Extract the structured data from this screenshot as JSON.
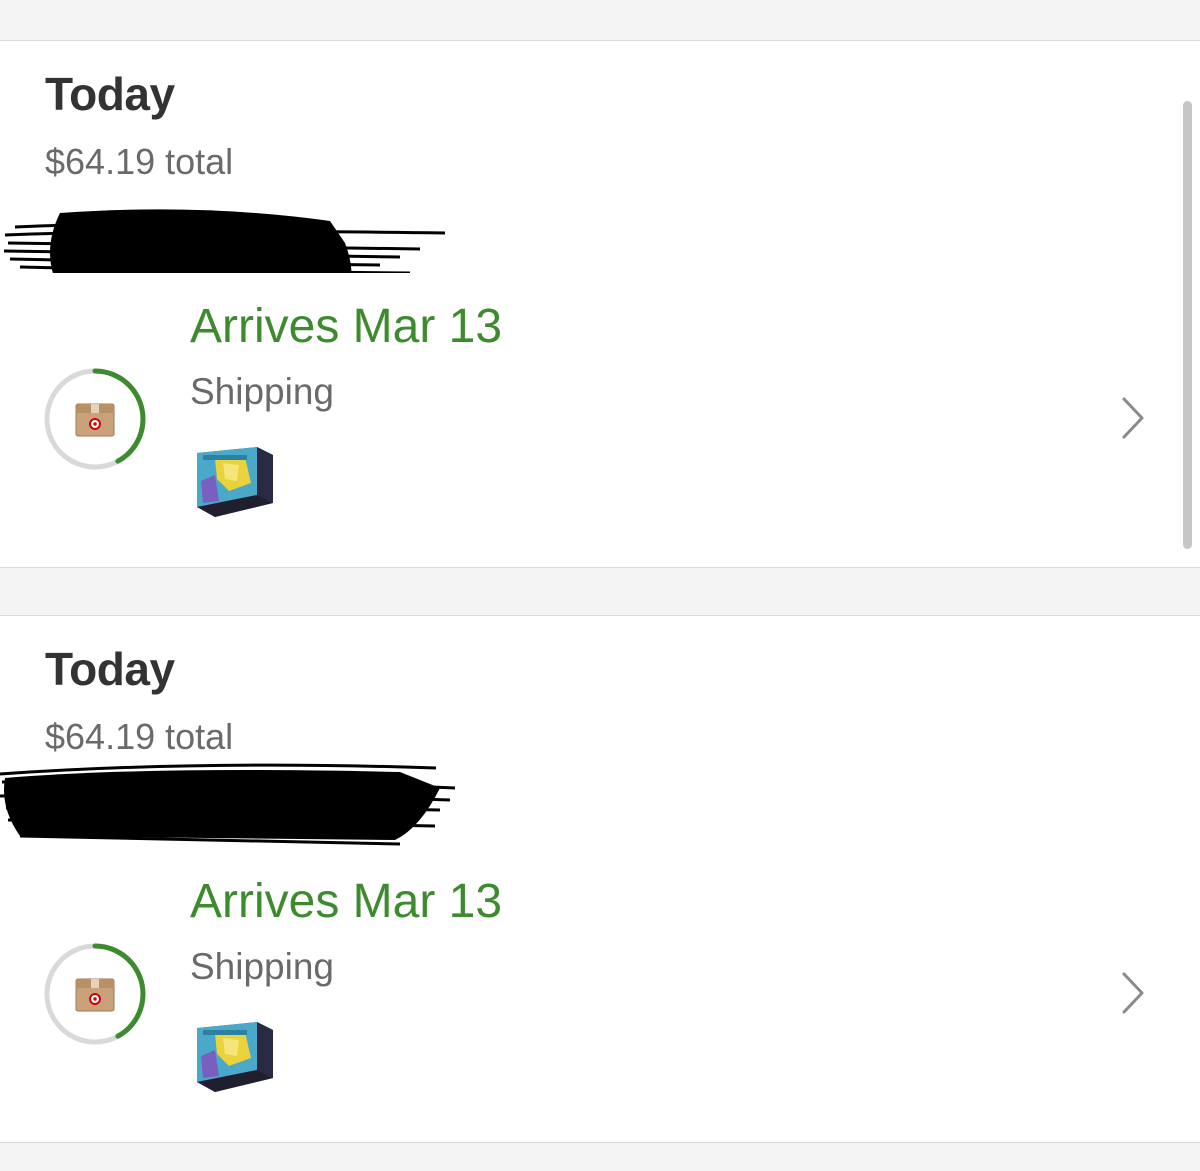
{
  "orders": [
    {
      "date": "Today",
      "total": "$64.19 total",
      "arrival": "Arrives Mar 13",
      "status": "Shipping",
      "progress": 0.42,
      "product_icon": "pokemon-tcg-elite-trainer-box",
      "status_icon": "package-box-icon",
      "redacted": true
    },
    {
      "date": "Today",
      "total": "$64.19 total",
      "arrival": "Arrives Mar 13",
      "status": "Shipping",
      "progress": 0.42,
      "product_icon": "pokemon-tcg-elite-trainer-box",
      "status_icon": "package-box-icon",
      "redacted": true
    }
  ],
  "colors": {
    "accent_green": "#3e8a2e",
    "progress_track": "#d9d9d9",
    "background": "#f4f4f4",
    "card": "#ffffff",
    "redaction": "#000000"
  }
}
